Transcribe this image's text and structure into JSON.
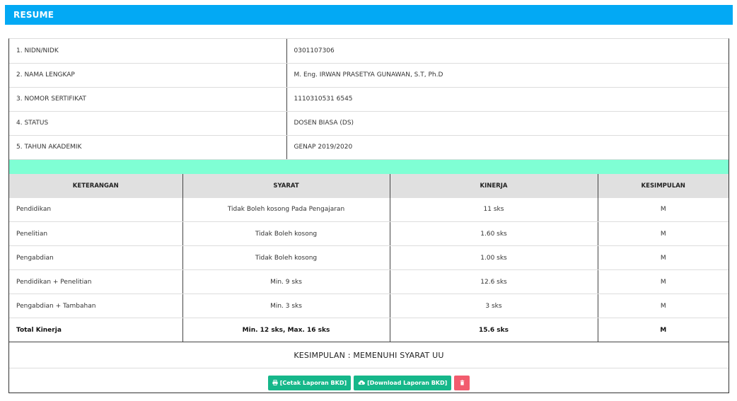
{
  "header": {
    "title": "RESUME"
  },
  "info": [
    {
      "label": "1. NIDN/NIDK",
      "value": "0301107306"
    },
    {
      "label": "2. NAMA LENGKAP",
      "value": "M. Eng. IRWAN PRASETYA GUNAWAN, S.T, Ph.D"
    },
    {
      "label": "3. NOMOR SERTIFIKAT",
      "value": "1110310531 6545"
    },
    {
      "label": "4. STATUS",
      "value": "DOSEN BIASA (DS)"
    },
    {
      "label": "5. TAHUN AKADEMIK",
      "value": "GENAP 2019/2020"
    }
  ],
  "performance": {
    "headers": [
      "KETERANGAN",
      "SYARAT",
      "KINERJA",
      "KESIMPULAN"
    ],
    "rows": [
      [
        "Pendidikan",
        "Tidak Boleh kosong Pada Pengajaran",
        "11 sks",
        "M"
      ],
      [
        "Penelitian",
        "Tidak Boleh kosong",
        "1.60 sks",
        "M"
      ],
      [
        "Pengabdian",
        "Tidak Boleh kosong",
        "1.00 sks",
        "M"
      ],
      [
        "Pendidikan + Penelitian",
        "Min. 9 sks",
        "12.6 sks",
        "M"
      ],
      [
        "Pengabdian + Tambahan",
        "Min. 3 sks",
        "3 sks",
        "M"
      ]
    ],
    "total": [
      "Total Kinerja",
      "Min. 12 sks, Max. 16 sks",
      "15.6 sks",
      "M"
    ]
  },
  "conclusion": "KESIMPULAN : MEMENUHI SYARAT UU",
  "actions": {
    "print_label": "[Cetak Laporan BKD]",
    "download_label": "[Download Laporan BKD]"
  },
  "colors": {
    "header": "#03a9f4",
    "spacer": "#7fffd4",
    "button_green": "#16b78a",
    "button_red": "#f25c6e"
  }
}
